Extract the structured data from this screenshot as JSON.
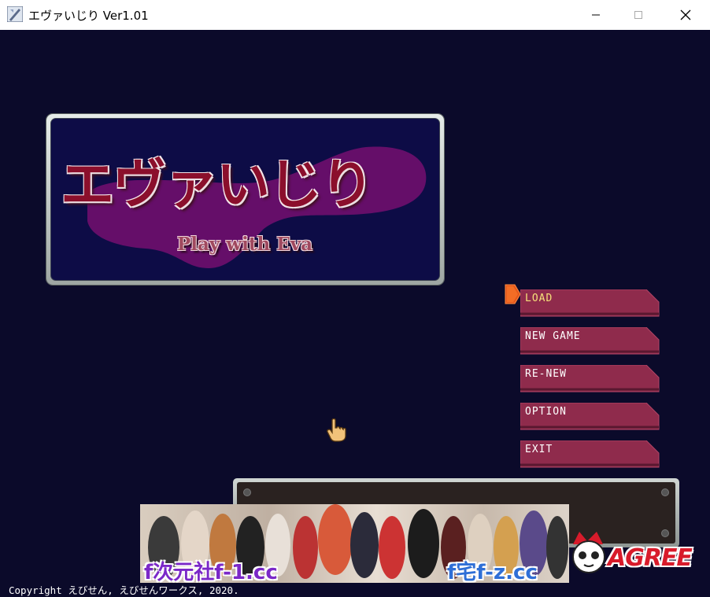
{
  "window": {
    "title": "エヴァいじり Ver1.01",
    "icon": "app-icon",
    "controls": [
      "minimize-icon",
      "maximize-icon",
      "close-icon"
    ]
  },
  "logo": {
    "title": "エヴァいじり",
    "subtitle": "Play with Eva"
  },
  "menu": {
    "items": [
      {
        "label": "LOAD",
        "selected": true
      },
      {
        "label": "NEW GAME",
        "selected": false
      },
      {
        "label": "RE-NEW",
        "selected": false
      },
      {
        "label": "OPTION",
        "selected": false
      },
      {
        "label": "EXIT",
        "selected": false
      }
    ],
    "selector_icon": "arrow-cursor-icon",
    "button_color": "#8f2b4c",
    "selected_text_color": "#f6e07a"
  },
  "cursor": {
    "icon": "hand-pointer-icon"
  },
  "message_box": {
    "text": ""
  },
  "banner": {
    "left_text": "f次元社f-1.cc",
    "right_text": "f宅f-z.cc"
  },
  "agree_logo": {
    "text": "AGREE"
  },
  "footer": {
    "copyright": "Copyright えびせん, えびせんワークス, 2020."
  },
  "colors": {
    "background": "#0b0a2a",
    "logo_panel": "#0d0c46",
    "logo_text": "#8b0f2c"
  }
}
